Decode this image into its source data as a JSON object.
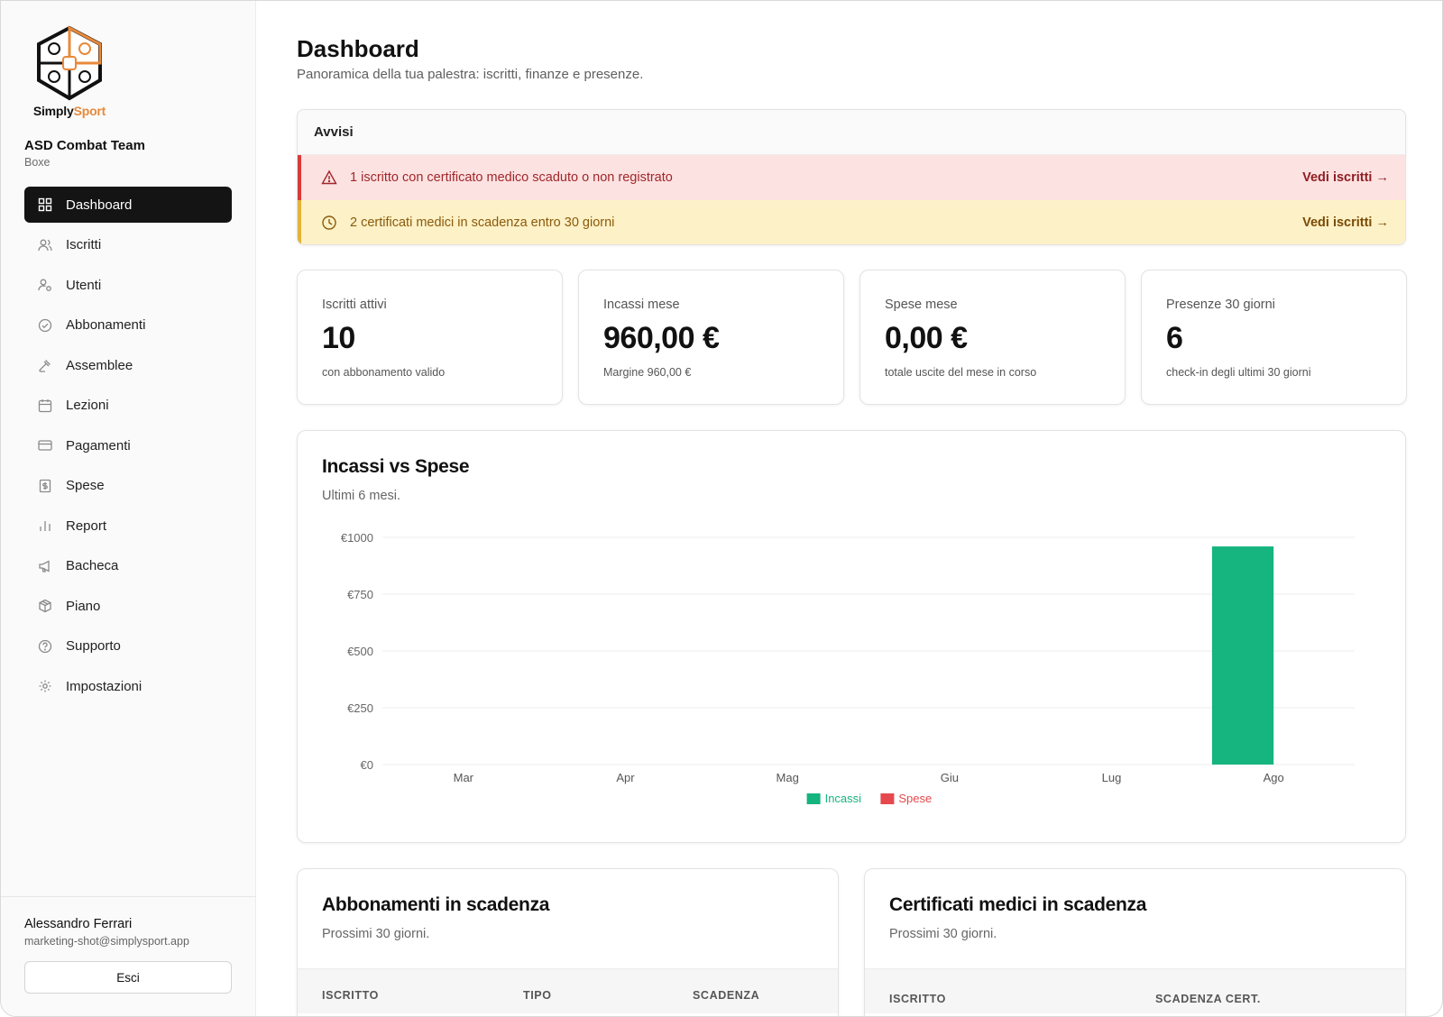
{
  "brand": {
    "name_part1": "Simply",
    "name_part2": "Sport"
  },
  "organization": {
    "name": "ASD Combat Team",
    "sport": "Boxe"
  },
  "nav": [
    {
      "label": "Dashboard",
      "icon": "grid-icon",
      "active": true
    },
    {
      "label": "Iscritti",
      "icon": "users-icon"
    },
    {
      "label": "Utenti",
      "icon": "user-cog-icon"
    },
    {
      "label": "Abbonamenti",
      "icon": "check-circle-icon"
    },
    {
      "label": "Assemblee",
      "icon": "gavel-icon"
    },
    {
      "label": "Lezioni",
      "icon": "calendar-icon"
    },
    {
      "label": "Pagamenti",
      "icon": "credit-card-icon"
    },
    {
      "label": "Spese",
      "icon": "receipt-icon"
    },
    {
      "label": "Report",
      "icon": "bar-chart-icon"
    },
    {
      "label": "Bacheca",
      "icon": "megaphone-icon"
    },
    {
      "label": "Piano",
      "icon": "package-icon"
    },
    {
      "label": "Supporto",
      "icon": "help-circle-icon"
    },
    {
      "label": "Impostazioni",
      "icon": "gear-icon"
    }
  ],
  "user": {
    "name": "Alessandro Ferrari",
    "email": "marketing-shot@simplysport.app",
    "logout_label": "Esci"
  },
  "page": {
    "title": "Dashboard",
    "subtitle": "Panoramica della tua palestra: iscritti, finanze e presenze."
  },
  "alerts": {
    "title": "Avvisi",
    "items": [
      {
        "text": "1 iscritto con certificato medico scaduto o non registrato",
        "link": "Vedi iscritti →",
        "level": "danger",
        "icon": "warning-triangle-icon"
      },
      {
        "text": "2 certificati medici in scadenza entro 30 giorni",
        "link": "Vedi iscritti →",
        "level": "warning",
        "icon": "clock-icon"
      }
    ]
  },
  "stats": [
    {
      "label": "Iscritti attivi",
      "value": "10",
      "note": "con abbonamento valido"
    },
    {
      "label": "Incassi mese",
      "value": "960,00 €",
      "note": "Margine 960,00 €"
    },
    {
      "label": "Spese mese",
      "value": "0,00 €",
      "note": "totale uscite del mese in corso"
    },
    {
      "label": "Presenze 30 giorni",
      "value": "6",
      "note": "check-in degli ultimi 30 giorni"
    }
  ],
  "chart_card": {
    "title": "Incassi vs Spese",
    "subtitle": "Ultimi 6 mesi."
  },
  "chart_data": {
    "type": "bar",
    "categories": [
      "Mar",
      "Apr",
      "Mag",
      "Giu",
      "Lug",
      "Ago"
    ],
    "series": [
      {
        "name": "Incassi",
        "color": "#16b47e",
        "values": [
          0,
          0,
          0,
          0,
          0,
          960
        ]
      },
      {
        "name": "Spese",
        "color": "#e5484d",
        "values": [
          0,
          0,
          0,
          0,
          0,
          0
        ]
      }
    ],
    "yticks": [
      "€0",
      "€250",
      "€500",
      "€750",
      "€1000"
    ],
    "ytick_values": [
      0,
      250,
      500,
      750,
      1000
    ],
    "ylim": [
      0,
      1000
    ],
    "grid": true,
    "legend": "bottom-center"
  },
  "subscriptions_card": {
    "title": "Abbonamenti in scadenza",
    "subtitle": "Prossimi 30 giorni.",
    "columns": [
      "ISCRITTO",
      "TIPO",
      "SCADENZA"
    ]
  },
  "certificates_card": {
    "title": "Certificati medici in scadenza",
    "subtitle": "Prossimi 30 giorni.",
    "columns": [
      "ISCRITTO",
      "SCADENZA CERT."
    ]
  }
}
